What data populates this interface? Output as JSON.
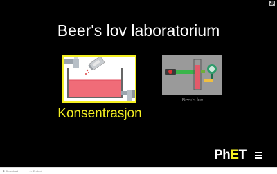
{
  "title": "Beer's lov laboratorium",
  "screens": [
    {
      "label": "Konsentrasjon",
      "selected": true
    },
    {
      "label": "Beer's lov",
      "selected": false
    }
  ],
  "logo": {
    "text_ph": "Ph",
    "text_e": "E",
    "text_t": "T"
  },
  "footer": {
    "download_label": "⬇ Download",
    "embed_label": "<> Embed"
  },
  "colors": {
    "background": "#000000",
    "accent": "#f4ef22",
    "solution": "#f06c78",
    "laser": "#3ab54a"
  },
  "icons": [
    "fullscreen-icon",
    "faucet-icon",
    "shaker-icon",
    "drain-faucet-icon",
    "laser-icon",
    "detector-icon",
    "menu-icon"
  ]
}
